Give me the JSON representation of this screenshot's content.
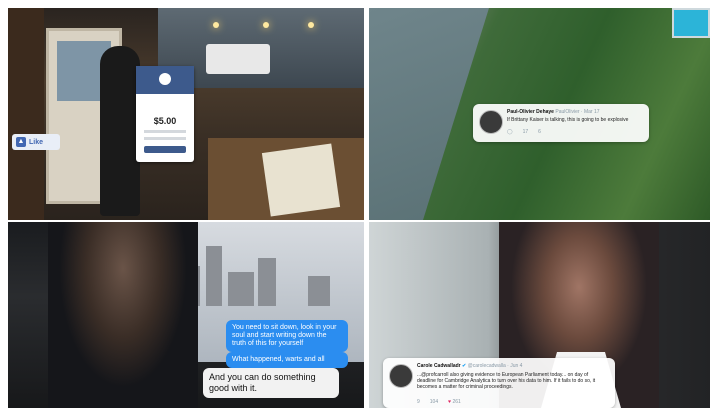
{
  "panel_top_left": {
    "payment_card": {
      "amount": "$5.00"
    },
    "like_button": {
      "label": "Like"
    }
  },
  "panel_top_right": {
    "tweet": {
      "name": "Paul-Olivier Dehaye",
      "handle": "PaulOlivier · Mar 17",
      "text": "If Brittany Kaiser is talking, this is going to be explosive",
      "actions": [
        "",
        "17",
        "6"
      ]
    }
  },
  "panel_bottom_left": {
    "messages": [
      {
        "side": "out",
        "text": "You need to sit down, look in your soul and start writing down the truth of this for yourself"
      },
      {
        "side": "out",
        "text": "What happened, warts and all"
      },
      {
        "side": "in",
        "text": "And you can do something good with it."
      }
    ]
  },
  "panel_bottom_right": {
    "tweet": {
      "name": "Carole Cadwalladr",
      "handle": "@carolecadwalla · Jun 4",
      "text": "...@profcarroll also giving evidence to European Parliament today... on day of deadline for Cambridge Analytica to turn over his data to him. If it fails to do so, it becomes a matter for criminal proceedings.",
      "actions": [
        "9",
        "104",
        "261"
      ]
    }
  },
  "colors": {
    "twitter_blue": "#1da1f2",
    "imessage_blue": "#2b8df0",
    "facebook_blue": "#4267b2"
  }
}
